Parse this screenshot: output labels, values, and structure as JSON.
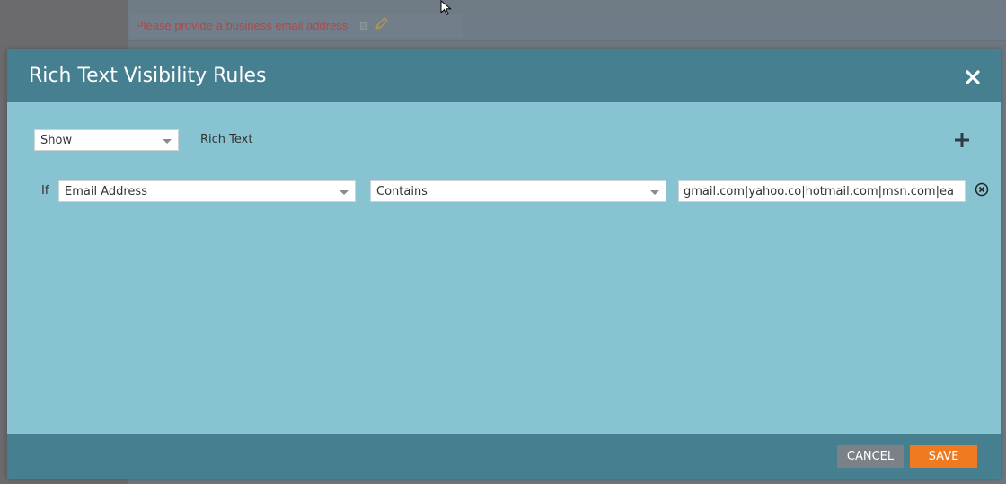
{
  "background": {
    "error_text": "Please provide a business email address"
  },
  "modal": {
    "title": "Rich Text Visibility Rules",
    "action_select": {
      "value": "Show"
    },
    "target_label": "Rich Text",
    "rule": {
      "if_label": "If",
      "field": "Email Address",
      "operator": "Contains",
      "value": "gmail.com|yahoo.co|hotmail.com|msn.com|ea"
    },
    "footer": {
      "cancel_label": "CANCEL",
      "save_label": "SAVE"
    }
  },
  "colors": {
    "header": "#457f90",
    "body": "#88c3d2",
    "save": "#ef7a1f",
    "cancel": "#7c8187",
    "error": "#b0484a"
  },
  "icons": [
    "close-icon",
    "plus-icon",
    "remove-circle-icon",
    "pencil-icon",
    "caret-down-icon",
    "cursor-icon"
  ]
}
